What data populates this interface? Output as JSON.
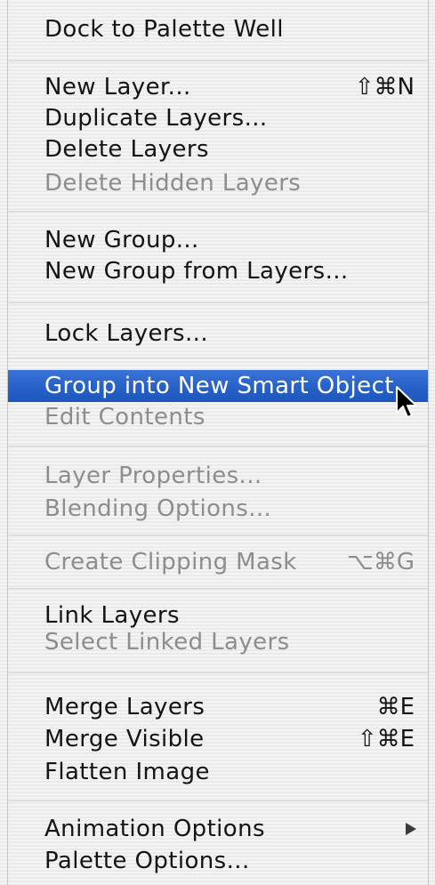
{
  "menu": {
    "groups": [
      [
        {
          "label": "Dock to Palette Well",
          "enabled": true
        }
      ],
      [
        {
          "label": "New Layer...",
          "shortcut": "⇧⌘N",
          "enabled": true
        },
        {
          "label": "Duplicate Layers...",
          "enabled": true
        },
        {
          "label": "Delete Layers",
          "enabled": true
        },
        {
          "label": "Delete Hidden Layers",
          "enabled": false
        }
      ],
      [
        {
          "label": "New Group...",
          "enabled": true
        },
        {
          "label": "New Group from Layers...",
          "enabled": true
        }
      ],
      [
        {
          "label": "Lock Layers...",
          "enabled": true
        }
      ],
      [
        {
          "label": "Group into New Smart Object",
          "enabled": true,
          "highlighted": true
        },
        {
          "label": "Edit Contents",
          "enabled": false
        }
      ],
      [
        {
          "label": "Layer Properties...",
          "enabled": false
        },
        {
          "label": "Blending Options...",
          "enabled": false
        }
      ],
      [
        {
          "label": "Create Clipping Mask",
          "shortcut": "⌥⌘G",
          "enabled": false
        }
      ],
      [
        {
          "label": "Link Layers",
          "enabled": true
        },
        {
          "label": "Select Linked Layers",
          "enabled": false
        }
      ],
      [
        {
          "label": "Merge Layers",
          "shortcut": "⌘E",
          "enabled": true
        },
        {
          "label": "Merge Visible",
          "shortcut": "⇧⌘E",
          "enabled": true
        },
        {
          "label": "Flatten Image",
          "enabled": true
        }
      ],
      [
        {
          "label": "Animation Options",
          "enabled": true,
          "submenu": true,
          "icon": "submenu-arrow-icon"
        },
        {
          "label": "Palette Options...",
          "enabled": true
        }
      ]
    ]
  },
  "cursor": {
    "icon": "arrow-cursor-icon"
  },
  "colors": {
    "highlight": "#2a64c9",
    "text": "#141414",
    "disabled_text": "#8d8d8d",
    "highlight_text": "#ffffff"
  }
}
